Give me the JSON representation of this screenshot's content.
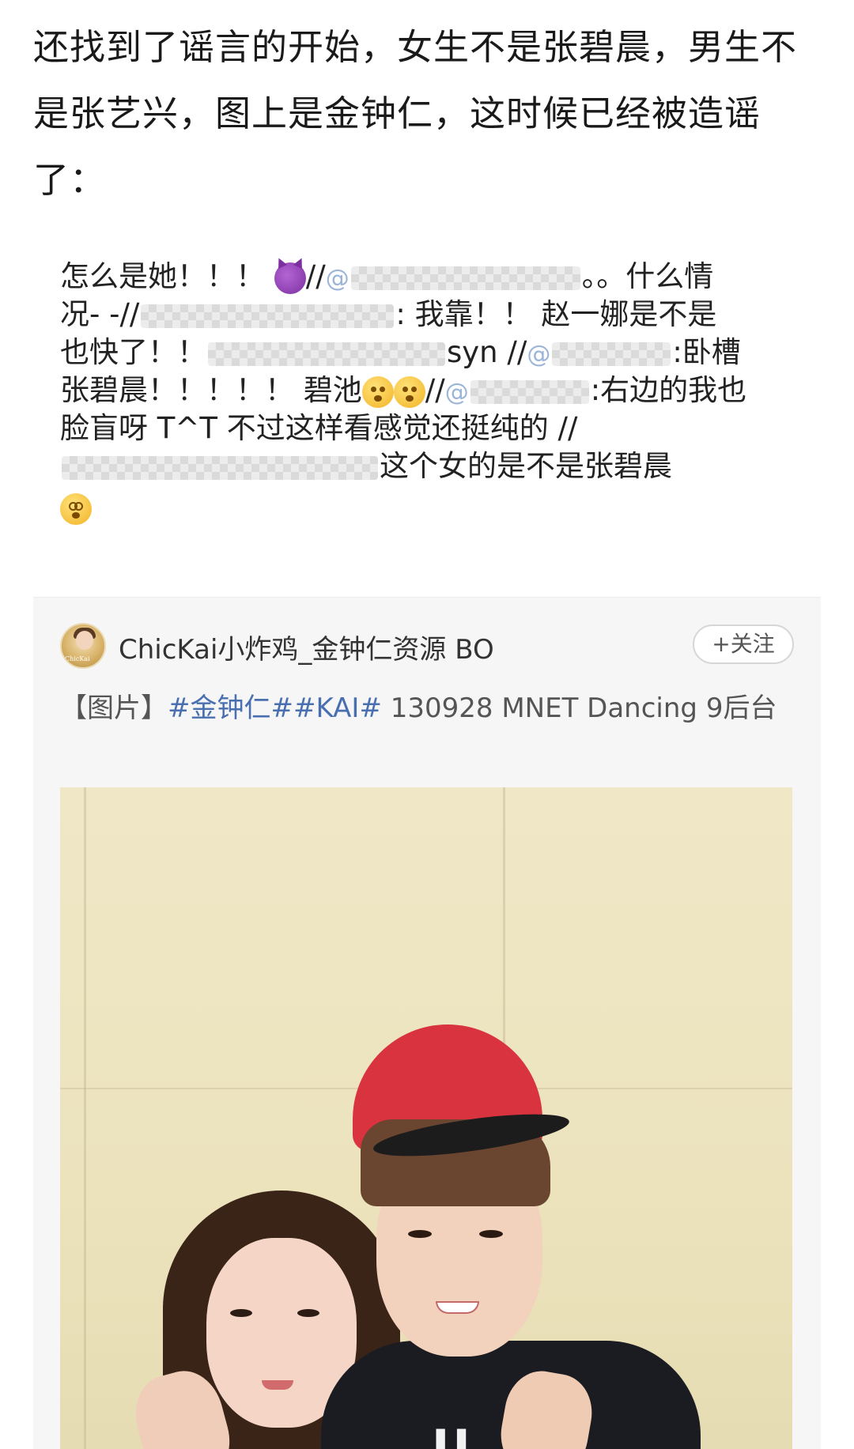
{
  "caption": {
    "line1": "还找到了谣言的开始，女生不是张碧晨，男生不",
    "line2": "是张艺兴，图上是金钟仁，这时候已经被造谣",
    "line3": "了："
  },
  "quote": {
    "l1_text": "怎么是她！！！",
    "l1_sep": "//",
    "l1_at": "@",
    "l1_tail": "。。什么情",
    "l2_head": "况- -//",
    "l2_tail": ": 我靠！！ 赵一娜是不是",
    "l3_head": "也快了！！",
    "l3_mid": "syn //",
    "l3_at": "@",
    "l3_tail": ":卧槽",
    "l4_head": "张碧晨！！！！！ 碧池",
    "l4_sep": "//",
    "l4_at": "@",
    "l4_tail": ":右边的我也",
    "l5_text": "脸盲呀 T^T 不过这样看感觉还挺纯的 //",
    "l6_tail": "这个女的是不是张碧晨",
    "emoji_icons": [
      "devil-emoji-icon",
      "thinking-emoji-icon",
      "dizzy-emoji-icon"
    ]
  },
  "post": {
    "username": "ChicKai小炸鸡_金钟仁资源 BO",
    "follow_label": "+关注",
    "text_prefix": "【图片】",
    "hashtags": "#金钟仁##KAI#",
    "text_suffix": " 130928 MNET Dancing 9后台",
    "avatar_tag": "ChicKai",
    "shirt_print": "U"
  },
  "colors": {
    "hashtag": "#4a6fb0",
    "post_bg": "#f6f6f7",
    "cap": "#d8333f",
    "wall": "#ece3bd"
  }
}
